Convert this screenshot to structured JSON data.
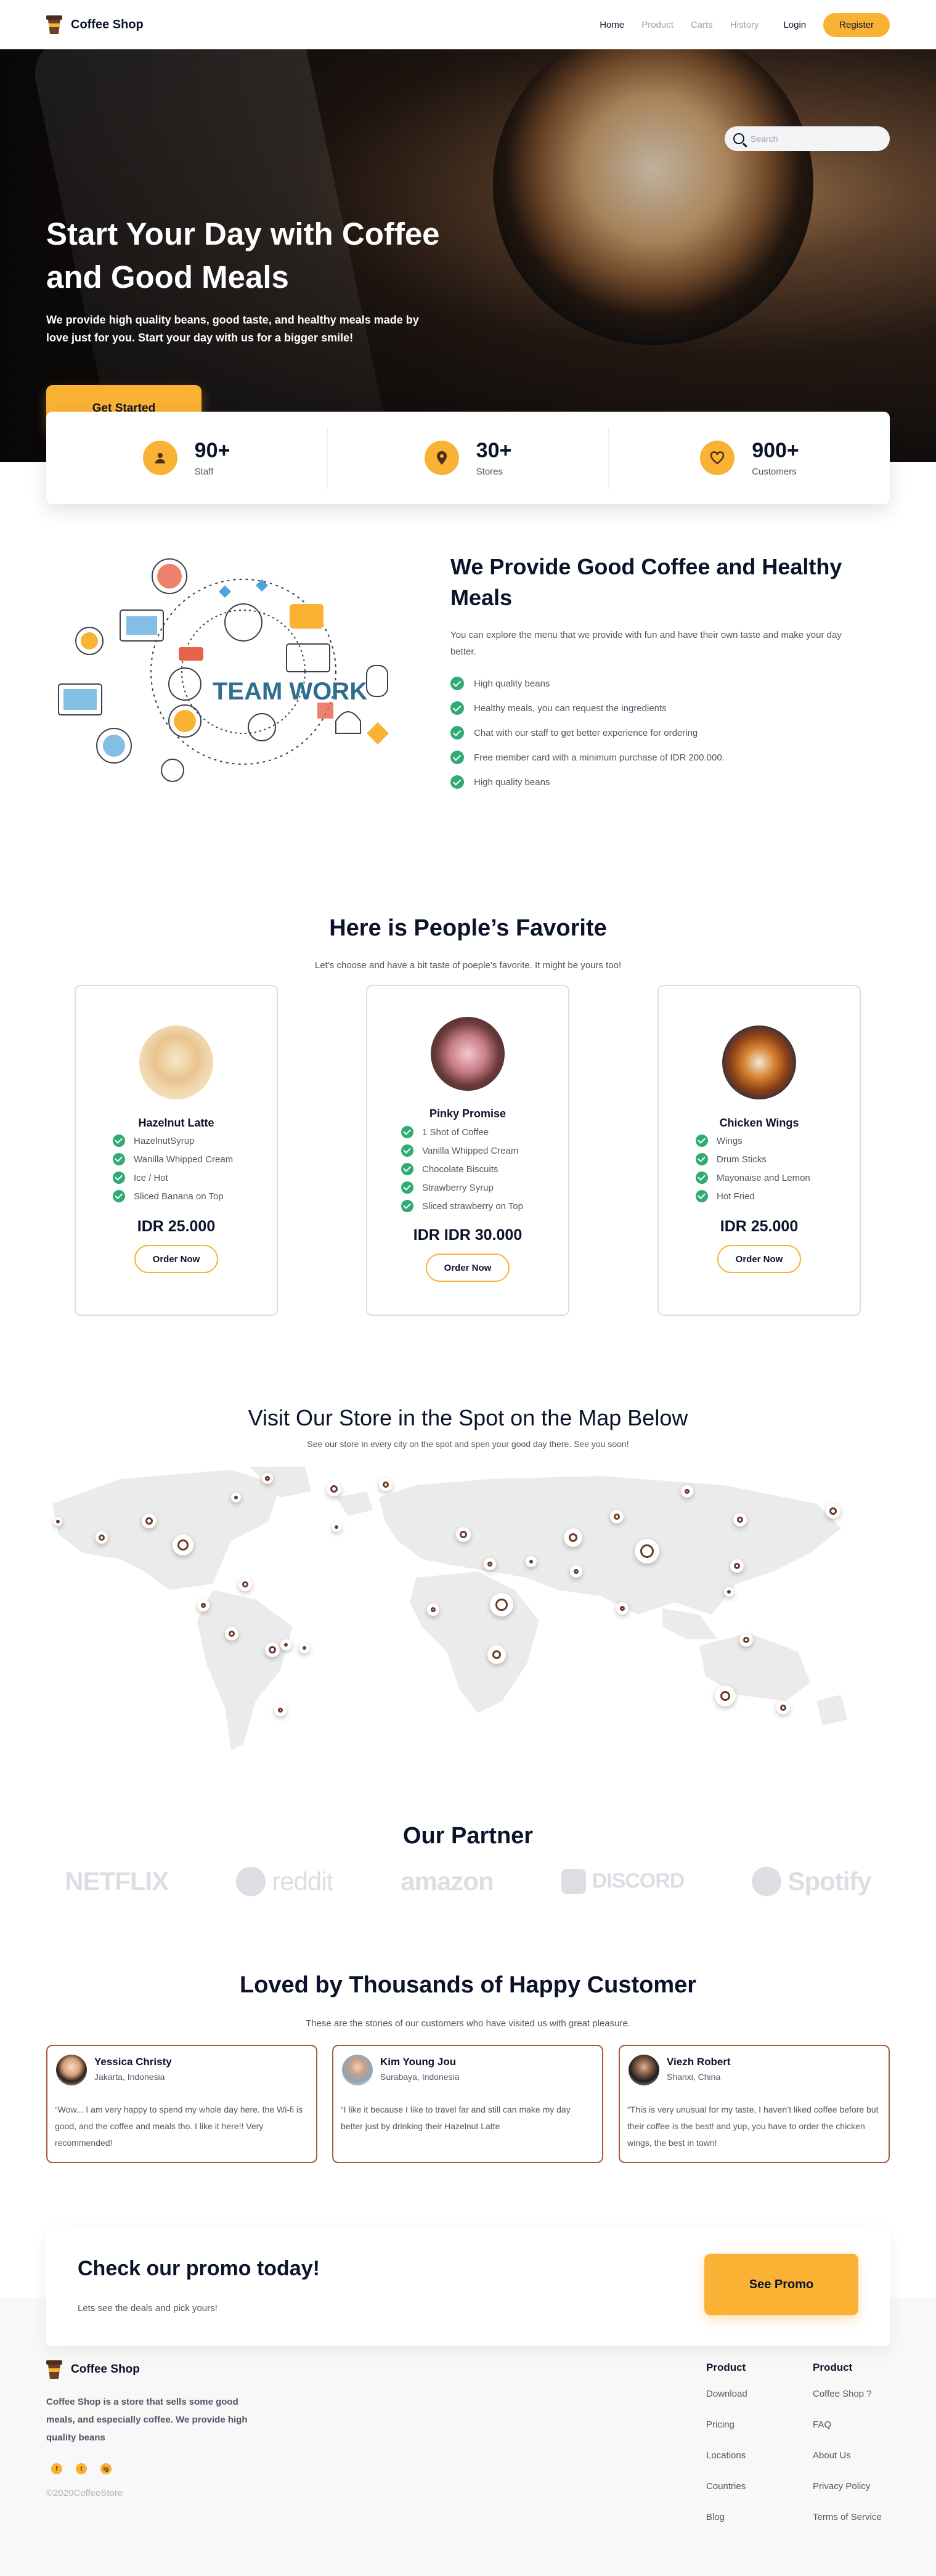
{
  "nav": {
    "brand": "Coffee Shop",
    "links": [
      "Home",
      "Product",
      "Carts",
      "History"
    ],
    "login": "Login",
    "register": "Register"
  },
  "search": {
    "placeholder": "Search"
  },
  "hero": {
    "title": "Start Your Day with Coffee and Good Meals",
    "subtitle": "We provide high quality beans, good taste, and healthy meals made by love just for you. Start your day with us for a bigger smile!",
    "cta": "Get Started"
  },
  "stats": [
    {
      "icon": "user-icon",
      "value": "90+",
      "label": "Staff"
    },
    {
      "icon": "location-pin-icon",
      "value": "30+",
      "label": "Stores"
    },
    {
      "icon": "heart-icon",
      "value": "900+",
      "label": "Customers"
    }
  ],
  "about": {
    "illustration_text": "TEAM WORK",
    "title": "We Provide Good Coffee and Healthy Meals",
    "description": "You can explore the menu that we provide with fun and have their own taste and make your day better.",
    "points": [
      "High quality beans",
      "Healthy meals, you can request the ingredients",
      "Chat with our staff to get better experience for ordering",
      "Free member card with a minimum purchase of IDR 200.000.",
      "High quality beans"
    ]
  },
  "favorites": {
    "title": "Here is People’s Favorite",
    "subtitle": "Let’s choose and have a bit taste of poeple’s favorite. It might be yours too!",
    "items": [
      {
        "name": "Hazelnut Latte",
        "features": [
          "HazelnutSyrup",
          "Wanilla Whipped Cream",
          "Ice / Hot",
          "Sliced Banana on Top"
        ],
        "price": "IDR 25.000",
        "button": "Order Now"
      },
      {
        "name": "Pinky Promise",
        "features": [
          "1 Shot of Coffee",
          "Vanilla Whipped Cream",
          "Chocolate Biscuits",
          "Strawberry Syrup",
          "Sliced strawberry on Top"
        ],
        "price": "IDR IDR 30.000",
        "button": "Order Now"
      },
      {
        "name": "Chicken Wings",
        "features": [
          "Wings",
          "Drum Sticks",
          "Mayonaise and Lemon",
          "Hot Fried"
        ],
        "price": "IDR 25.000",
        "button": "Order Now"
      }
    ]
  },
  "map": {
    "title": "Visit Our Store in the Spot on the Map Below",
    "subtitle": "See our store in every city on the spot and spen your good day there. See you soon!"
  },
  "partners": {
    "title": "Our Partner",
    "logos": [
      "NETFLIX",
      "reddit",
      "amazon",
      "DISCORD",
      "Spotify"
    ]
  },
  "testimonials": {
    "title": "Loved by Thousands of Happy Customer",
    "subtitle": "These are the stories of our customers who have visited us with great pleasure.",
    "items": [
      {
        "name": "Yessica Christy",
        "location": "Jakarta, Indonesia",
        "quote": "“Wow... I am very happy to spend my whole day here. the Wi-fi is good, and the coffee and meals tho. I like it here!! Very recommended!"
      },
      {
        "name": "Kim Young Jou",
        "location": "Surabaya, Indonesia",
        "quote": "“I like it because I like to travel far and still can make my day better just by drinking their Hazelnut Latte"
      },
      {
        "name": "Viezh Robert",
        "location": "Shanxi, China",
        "quote": "“This is very unusual for my taste, I haven’t liked coffee before but their coffee is the best! and yup, you have to order the chicken wings, the best in town!"
      }
    ]
  },
  "promo": {
    "title": "Check our promo today!",
    "subtitle": "Lets see the deals and pick yours!",
    "button": "See Promo"
  },
  "footer": {
    "brand": "Coffee Shop",
    "description": "Coffee Shop is a store that sells some good meals, and especially coffee. We provide high quality beans",
    "social": [
      "f",
      "t",
      "ig"
    ],
    "copyright": "©2020CoffeeStore",
    "col1": {
      "title": "Product",
      "links": [
        "Download",
        "Pricing",
        "Locations",
        "Countries",
        "Blog"
      ]
    },
    "col2": {
      "title": "Product",
      "links": [
        "Coffee Shop ?",
        "FAQ",
        "About Us",
        "Privacy Policy",
        "Terms of Service"
      ]
    }
  },
  "colors": {
    "accent": "#f9b233",
    "dark": "#0b132a",
    "check": "#2fab73",
    "testimonial_border": "#a9573d"
  }
}
